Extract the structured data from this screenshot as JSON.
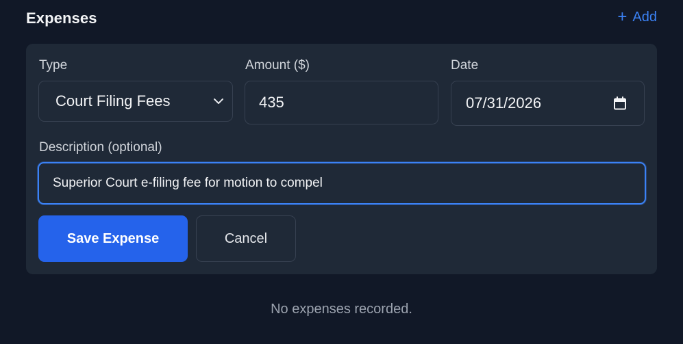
{
  "section": {
    "title": "Expenses",
    "add_label": "Add",
    "add_icon": "plus-icon"
  },
  "form": {
    "type_label": "Type",
    "type_value": "Court Filing Fees",
    "amount_label": "Amount ($)",
    "amount_value": "435",
    "date_label": "Date",
    "date_value": "07/31/2026",
    "description_label": "Description (optional)",
    "description_value": "Superior Court e-filing fee for motion to compel",
    "save_label": "Save Expense",
    "cancel_label": "Cancel"
  },
  "empty_state": "No expenses recorded.",
  "colors": {
    "background": "#111827",
    "card": "#1f2937",
    "accent": "#2563eb",
    "link": "#3b82f6"
  }
}
